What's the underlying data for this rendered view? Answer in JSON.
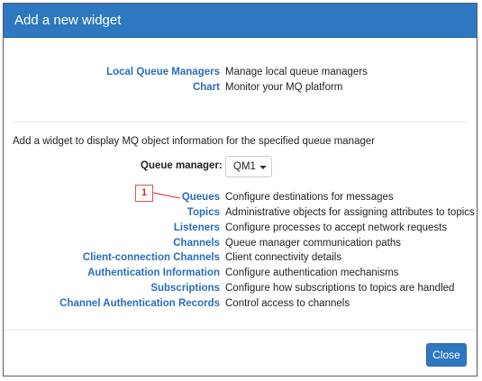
{
  "dialog": {
    "title": "Add a new widget",
    "close_label": "Close"
  },
  "general_widgets": [
    {
      "label": "Local Queue Managers",
      "description": "Manage local queue managers"
    },
    {
      "label": "Chart",
      "description": "Monitor your MQ platform"
    }
  ],
  "object_section": {
    "intro": "Add a widget to display MQ object information for the specified queue manager",
    "queue_manager_label": "Queue manager:",
    "queue_manager_value": "QM1"
  },
  "object_widgets": [
    {
      "label": "Queues",
      "description": "Configure destinations for messages"
    },
    {
      "label": "Topics",
      "description": "Administrative objects for assigning attributes to topics"
    },
    {
      "label": "Listeners",
      "description": "Configure processes to accept network requests"
    },
    {
      "label": "Channels",
      "description": "Queue manager communication paths"
    },
    {
      "label": "Client-connection Channels",
      "description": "Client connectivity details"
    },
    {
      "label": "Authentication Information",
      "description": "Configure authentication mechanisms"
    },
    {
      "label": "Subscriptions",
      "description": "Configure how subscriptions to topics are handled"
    },
    {
      "label": "Channel Authentication Records",
      "description": "Control access to channels"
    }
  ],
  "callout": {
    "number": "1",
    "color": "#d9534f"
  },
  "colors": {
    "header": "#2e78c2",
    "link": "#2a6ebb",
    "button": "#2e78c2"
  }
}
